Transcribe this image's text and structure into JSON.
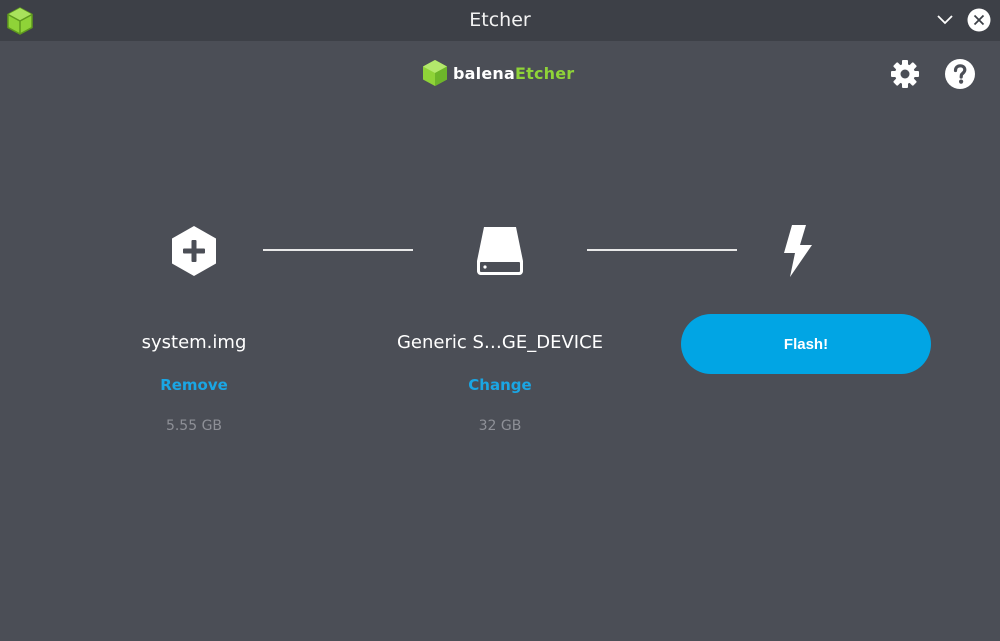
{
  "window": {
    "title": "Etcher"
  },
  "header": {
    "brand_part1": "balena",
    "brand_part2": "Etcher",
    "brand_color": "#8fd338",
    "settings_icon": "gear-icon",
    "help_icon": "question-circle-icon"
  },
  "steps": {
    "image": {
      "icon": "plus-hexagon-icon",
      "name": "system.img",
      "action": "Remove",
      "size": "5.55 GB"
    },
    "drive": {
      "icon": "drive-icon",
      "name": "Generic S…GE_DEVICE",
      "action": "Change",
      "size": "32 GB"
    },
    "flash": {
      "icon": "lightning-icon",
      "button_label": "Flash!"
    }
  },
  "colors": {
    "background": "#4b4e56",
    "titlebar": "#3d4047",
    "accent": "#01a5e4",
    "link": "#1aa6e4",
    "muted": "#8e9097"
  }
}
